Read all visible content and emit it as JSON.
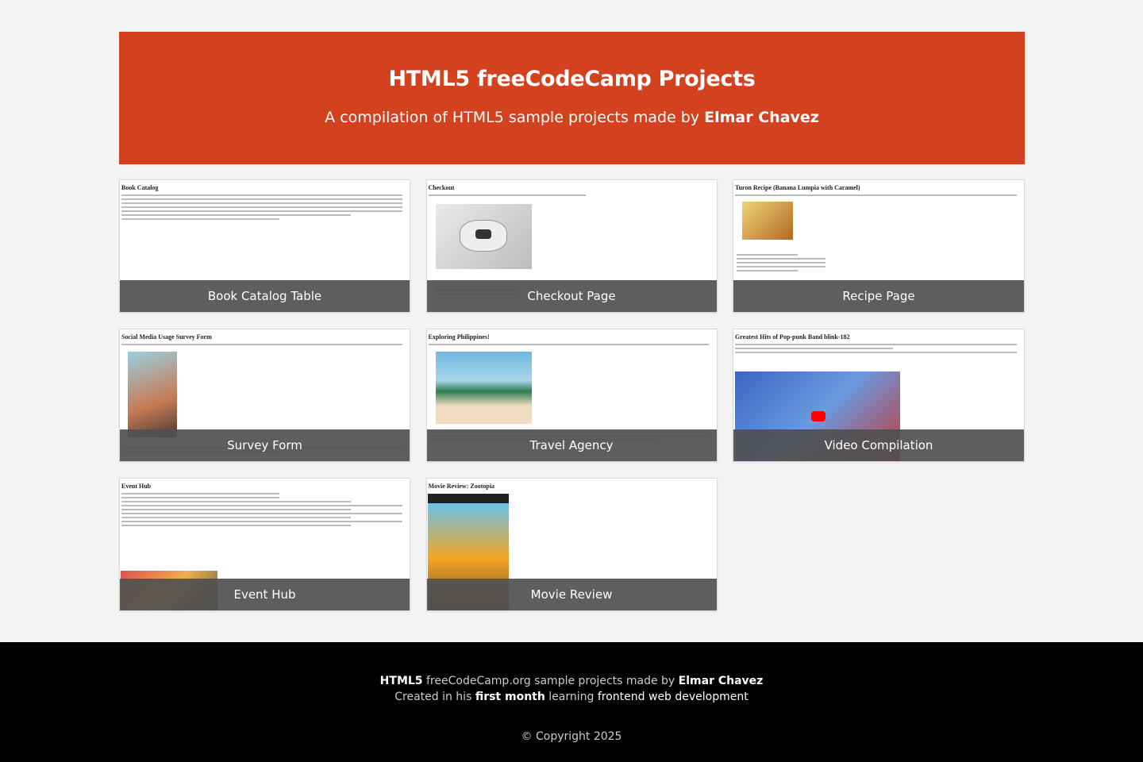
{
  "header": {
    "title": "HTML5 freeCodeCamp Projects",
    "subtitle_prefix": "A compilation of HTML5 sample projects made by",
    "author": "Elmar Chavez"
  },
  "projects": [
    {
      "label": "Book Catalog Table",
      "preview_title": "Book Catalog"
    },
    {
      "label": "Checkout Page",
      "preview_title": "Checkout"
    },
    {
      "label": "Recipe Page",
      "preview_title": "Turon Recipe (Banana Lumpia with Caramel)"
    },
    {
      "label": "Survey Form",
      "preview_title": "Social Media Usage Survey Form"
    },
    {
      "label": "Travel Agency",
      "preview_title": "Exploring Philippines!"
    },
    {
      "label": "Video Compilation",
      "preview_title": "Greatest Hits of Pop-punk Band blink-182"
    },
    {
      "label": "Event Hub",
      "preview_title": "Event Hub"
    },
    {
      "label": "Movie Review",
      "preview_title": "Movie Review: Zootopia"
    }
  ],
  "footer": {
    "line1_prefix": "HTML5",
    "line1_mid": "freeCodeCamp.org sample projects made by",
    "author": "Elmar Chavez",
    "line2_a": "Created in his",
    "line2_b": "first month",
    "line2_c": "learning",
    "line2_d": "frontend web development",
    "copyright": "© Copyright 2025"
  },
  "colors": {
    "accent": "#d4411e",
    "footer_bg": "#000000",
    "page_bg": "#f3f3f3"
  }
}
